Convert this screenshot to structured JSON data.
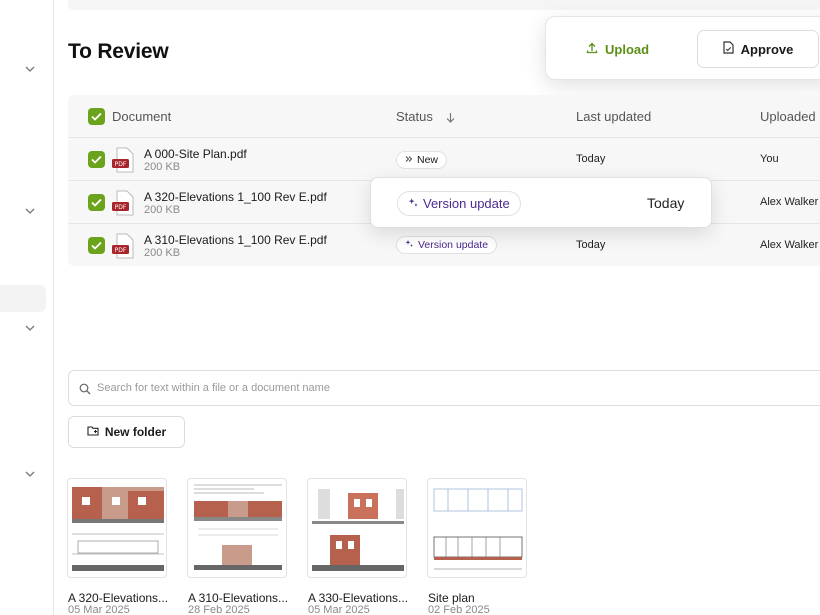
{
  "page": {
    "title": "To Review"
  },
  "actions": {
    "upload_label": "Upload",
    "approve_label": "Approve"
  },
  "table": {
    "headers": {
      "document": "Document",
      "status": "Status",
      "last_updated": "Last updated",
      "uploaded": "Uploaded"
    },
    "rows": [
      {
        "name": "A 000-Site Plan.pdf",
        "size": "200 KB",
        "status": "New",
        "updated": "Today",
        "uploaded_by": "You"
      },
      {
        "name": "A 320-Elevations 1_100 Rev E.pdf",
        "size": "200 KB",
        "status": "Version update",
        "updated": "Today",
        "uploaded_by": "Alex Walker"
      },
      {
        "name": "A 310-Elevations 1_100 Rev E.pdf",
        "size": "200 KB",
        "status": "Version update",
        "updated": "Today",
        "uploaded_by": "Alex Walker"
      }
    ],
    "pdf_label": "PDF"
  },
  "hover_card": {
    "status": "Version update",
    "updated": "Today"
  },
  "search": {
    "placeholder": "Search for text within a file or a document name"
  },
  "new_folder_label": "New folder",
  "files": [
    {
      "name": "A 320-Elevations...",
      "date": "05 Mar 2025"
    },
    {
      "name": "A 310-Elevations...",
      "date": "28 Feb 2025"
    },
    {
      "name": "A 330-Elevations...",
      "date": "05 Mar 2025"
    },
    {
      "name": "Site plan",
      "date": "02 Feb 2025"
    }
  ],
  "colors": {
    "accent": "#6ba31c",
    "upload_text": "#5c8f14",
    "version_text": "#4b2a8e",
    "pdf_red": "#a8262b"
  },
  "icons": [
    "chevron-down-icon",
    "upload-icon",
    "document-icon",
    "check-icon",
    "pdf-icon",
    "arrow-down-icon",
    "sparkle-icon",
    "search-icon",
    "folder-plus-icon"
  ]
}
